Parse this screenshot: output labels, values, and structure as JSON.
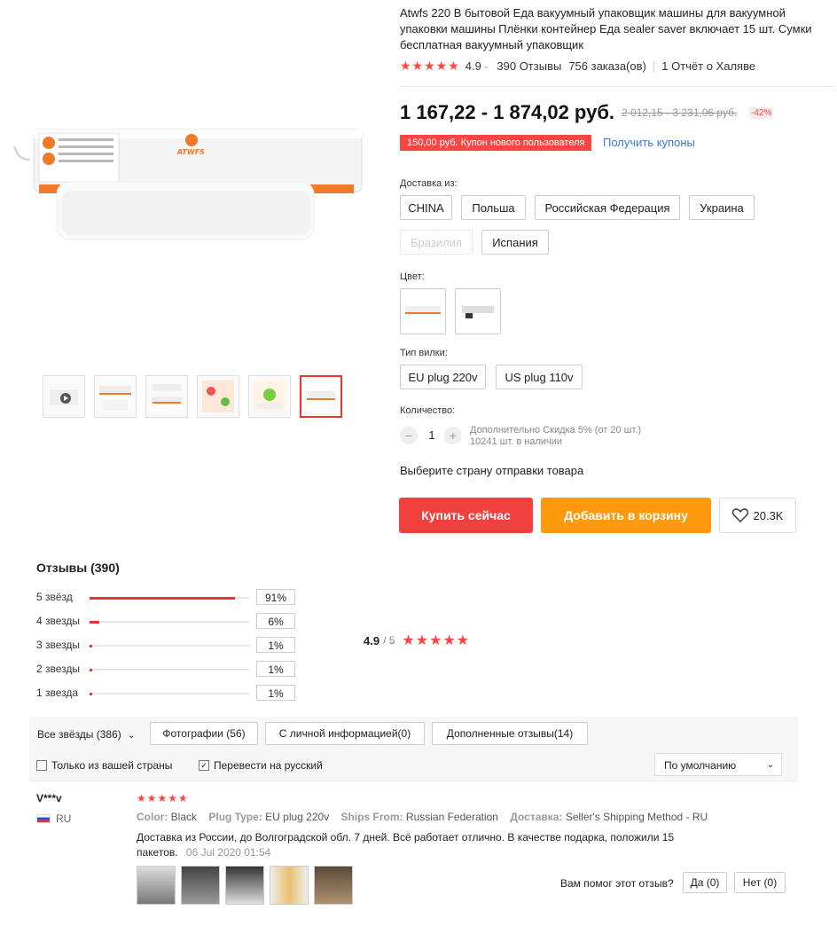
{
  "product": {
    "title": "Atwfs 220 В бытовой Еда вакуумный упаковщик машины для вакуумной упаковки машины Плёнки контейнер Еда sealer saver включает 15 шт. Сумки бесплатная вакуумный упаковщик",
    "rating": "4.9",
    "reviews": "390 Отзывы",
    "orders": "756 заказа(ов)",
    "report": "1 Отчёт о Халяве",
    "price": "1 167,22 - 1 874,02 руб.",
    "old_price": "2 012,15 - 3 231,06 руб.",
    "discount": "-42%",
    "coupon": "150,00 руб. Купон нового пользователя",
    "coupon_link": "Получить купоны",
    "brand_on_image": "ATWFS"
  },
  "shipping": {
    "label": "Доставка из:",
    "options": [
      "CHINA",
      "Польша",
      "Российская Федерация",
      "Украина",
      "Бразилия",
      "Испания"
    ]
  },
  "color": {
    "label": "Цвет:"
  },
  "plug": {
    "label": "Тип вилки:",
    "options": [
      "EU plug 220v",
      "US plug 110v"
    ]
  },
  "quantity": {
    "label": "Количество:",
    "minus": "−",
    "plus": "+",
    "value": "1",
    "discount_note": "Дополнительно Скидка 5% (от 20 шт.)",
    "stock": "10241 шт. в наличии"
  },
  "select_country": "Выберите страну отправки товара",
  "actions": {
    "buy": "Купить сейчас",
    "cart": "Добавить в корзину",
    "wishlist_count": "20.3K",
    "buy_color": "#f2403f",
    "cart_color": "#ff9a0c"
  },
  "reviews": {
    "title": "Отзывы (390)",
    "bars": [
      {
        "label": "5 звёзд",
        "pct": "91%",
        "value": 0.91
      },
      {
        "label": "4 звезды",
        "pct": "6%",
        "value": 0.06
      },
      {
        "label": "3 звезды",
        "pct": "1%",
        "value": 0.01
      },
      {
        "label": "2 звезды",
        "pct": "1%",
        "value": 0.01
      },
      {
        "label": "1 звезда",
        "pct": "1%",
        "value": 0.01
      }
    ],
    "avg": "4.9",
    "avg_max": "/ 5",
    "filters": {
      "all": "Все звёзды (386)",
      "photos": "Фотографии (56)",
      "personal": "С личной информацией(0)",
      "additional": "Дополненные отзывы(14)",
      "only_country": "Только из вашей страны",
      "translate": "Перевести на русский",
      "sort": "По умолчанию"
    },
    "items": [
      {
        "user": "V***v",
        "country": "RU",
        "stars": "★★★★★",
        "color_label": "Color:",
        "color_value": "Black",
        "plug_label": "Plug Type:",
        "plug_value": "EU plug 220v",
        "ships_label": "Ships From:",
        "ships_value": "Russian Federation",
        "delivery_label": "Доставка:",
        "delivery_value": "Seller's Shipping Method - RU",
        "text": "Доставка из России, до Волгоградской обл. 7 дней. Всё работает отлично. В качестве подарка, положили 15 пакетов.",
        "date": "06 Jul 2020 01:54",
        "helpful": "Вам помог этот отзыв?",
        "yes": "Да (0)",
        "no": "Нет (0)"
      }
    ]
  }
}
